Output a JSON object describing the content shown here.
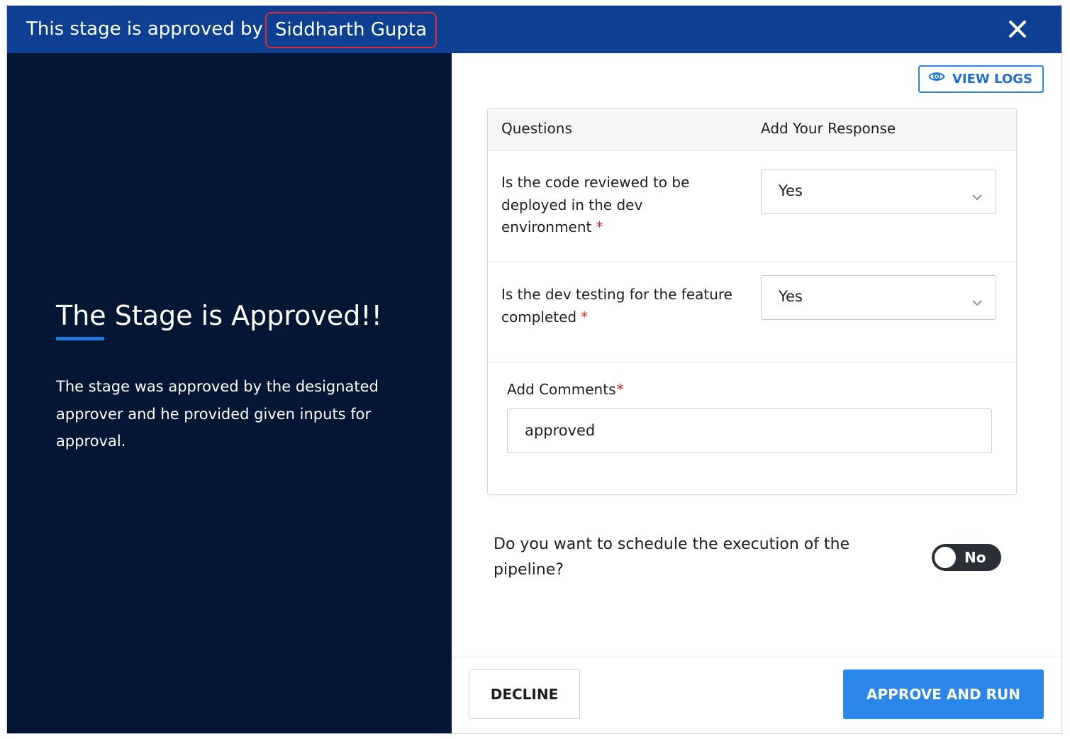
{
  "header": {
    "prefix": "This stage is approved by",
    "approver_name": "Siddharth Gupta",
    "close_icon": "close-icon",
    "background_color": "#0d3f92",
    "highlight_color": "#e12b2b"
  },
  "left_panel": {
    "title": "The Stage is Approved!!",
    "description": "The stage was approved by the designated approver and he provided given inputs for approval.",
    "background_color": "#031634",
    "accent_color": "#1f7ae0"
  },
  "toolbar": {
    "view_logs_label": "VIEW LOGS",
    "view_logs_icon": "eye-icon"
  },
  "questions_table": {
    "headers": [
      "Questions",
      "Add Your Response"
    ],
    "rows": [
      {
        "question": "Is the code reviewed to be deployed in the dev environment",
        "required_mark": "*",
        "response": "Yes"
      },
      {
        "question": "Is the dev testing for the feature completed",
        "required_mark": "*",
        "response": "Yes"
      }
    ],
    "comments_label": "Add Comments",
    "comments_required_mark": "*",
    "comments_value": "approved"
  },
  "schedule": {
    "question": "Do you want to schedule the execution of the pipeline?",
    "toggle_label": "No",
    "enabled": false
  },
  "footer": {
    "decline_label": "DECLINE",
    "approve_label": "APPROVE AND RUN",
    "approve_color": "#2b86ea"
  }
}
